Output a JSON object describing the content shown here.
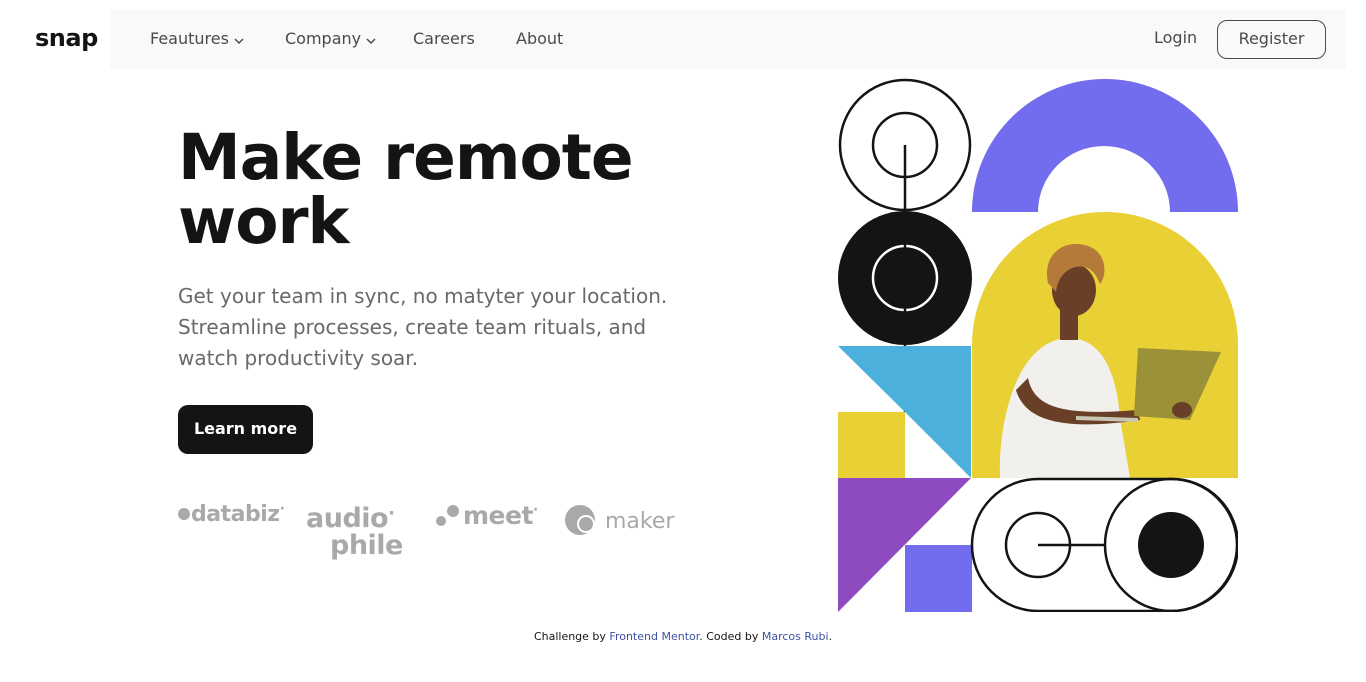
{
  "brand": {
    "logo": "snap"
  },
  "nav": {
    "items": [
      {
        "label": "Feautures",
        "has_dropdown": true
      },
      {
        "label": "Company",
        "has_dropdown": true
      },
      {
        "label": "Careers",
        "has_dropdown": false
      },
      {
        "label": "About",
        "has_dropdown": false
      }
    ],
    "login": "Login",
    "register": "Register"
  },
  "hero": {
    "title_line1": "Make remote",
    "title_line2": "work",
    "subtitle": "Get your team in sync, no matyter your location. Streamline processes, create team rituals, and watch productivity soar.",
    "cta": "Learn more"
  },
  "clients": {
    "databiz": "databiz",
    "databiz_mark": "·",
    "audiophile_1": "audio",
    "audiophile_2": "phile",
    "audiophile_mark": "·",
    "meet": "meet",
    "meet_mark": "·",
    "maker": "maker"
  },
  "colors": {
    "purple": "#726cee",
    "yellow": "#e9d035",
    "blue": "#4bb1dc",
    "violet": "#8e4bbf",
    "dark": "#141414",
    "link": "#3e52a3"
  },
  "footer": {
    "prefix": "Challenge by",
    "link1": "Frontend Mentor",
    "middle": ". Coded by",
    "link2": "Marcos Rubi",
    "suffix": "."
  }
}
